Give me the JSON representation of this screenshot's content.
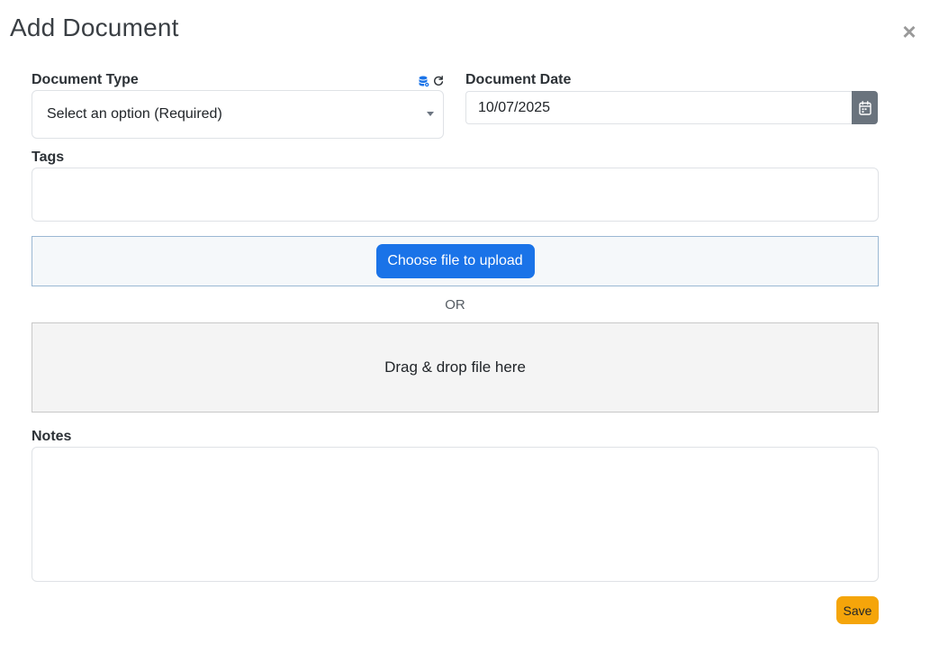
{
  "modal": {
    "title": "Add Document",
    "close_glyph": "×"
  },
  "document_type": {
    "label": "Document Type",
    "placeholder": "Select an option (Required)",
    "icons": [
      "database-settings-icon",
      "refresh-icon"
    ]
  },
  "document_date": {
    "label": "Document Date",
    "value": "10/07/2025",
    "icon": "calendar-icon"
  },
  "tags": {
    "label": "Tags",
    "value": ""
  },
  "upload": {
    "button_label": "Choose file to upload",
    "or_text": "OR",
    "drop_text": "Drag & drop file here"
  },
  "notes": {
    "label": "Notes",
    "value": ""
  },
  "actions": {
    "save_label": "Save"
  },
  "colors": {
    "primary": "#1a73e8",
    "save": "#f5a50a",
    "date_button": "#6a737d",
    "db_icon": "#1a73e8"
  }
}
